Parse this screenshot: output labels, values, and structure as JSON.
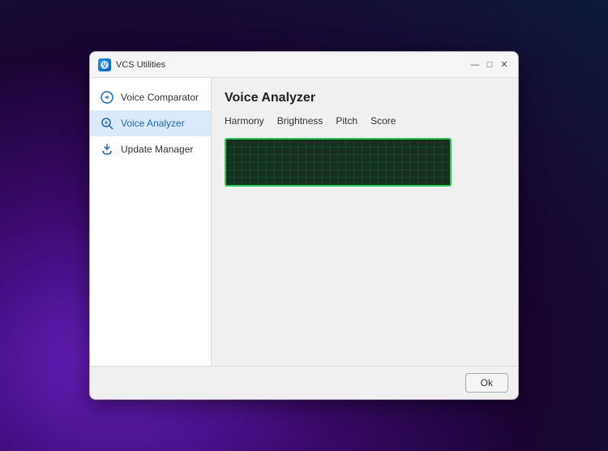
{
  "window": {
    "title": "VCS Utilities",
    "app_icon_color": "#1e90ff"
  },
  "titlebar": {
    "title": "VCS Utilities",
    "minimize_label": "—",
    "maximize_label": "□",
    "close_label": "✕"
  },
  "sidebar": {
    "items": [
      {
        "id": "voice-comparator",
        "label": "Voice Comparator",
        "active": false
      },
      {
        "id": "voice-analyzer",
        "label": "Voice Analyzer",
        "active": true
      },
      {
        "id": "update-manager",
        "label": "Update Manager",
        "active": false
      }
    ]
  },
  "main": {
    "title": "Voice Analyzer",
    "tabs": [
      {
        "id": "harmony",
        "label": "Harmony",
        "active": true
      },
      {
        "id": "brightness",
        "label": "Brightness",
        "active": false
      },
      {
        "id": "pitch",
        "label": "Pitch",
        "active": false
      },
      {
        "id": "score",
        "label": "Score",
        "active": false
      }
    ]
  },
  "footer": {
    "ok_label": "Ok"
  }
}
